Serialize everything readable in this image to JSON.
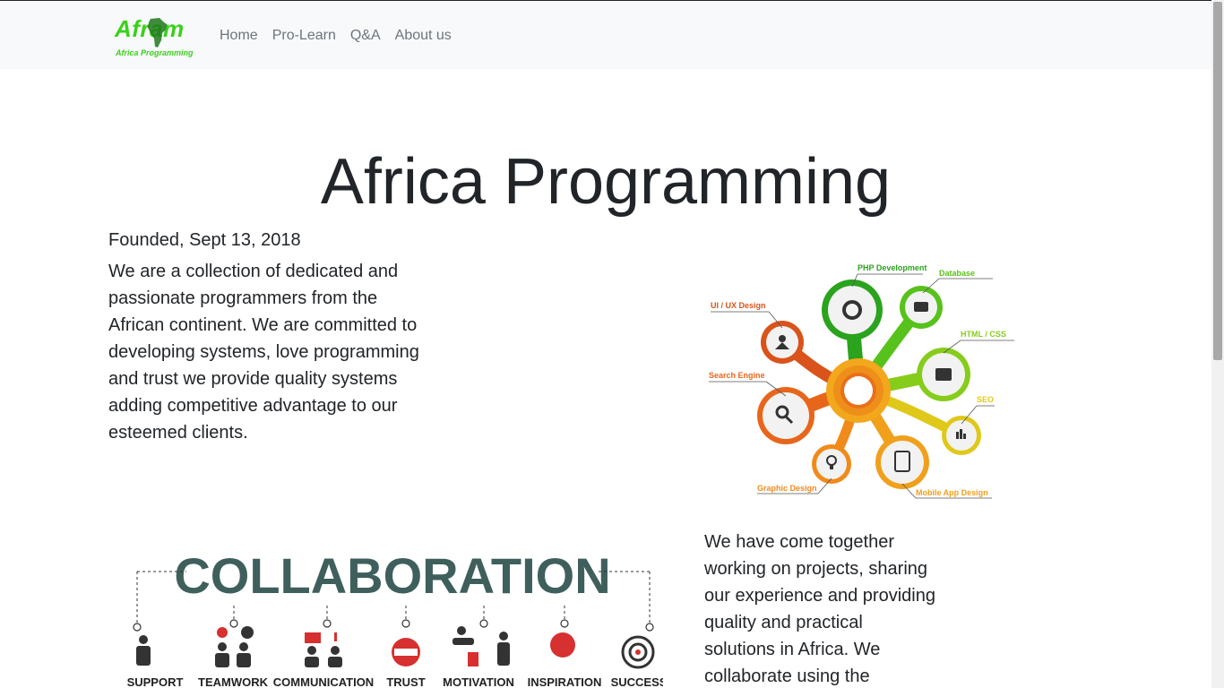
{
  "navbar": {
    "logo": {
      "word": "Afram",
      "subtitle": "Africa Programming"
    },
    "links": [
      {
        "label": "Home"
      },
      {
        "label": "Pro-Learn"
      },
      {
        "label": "Q&A"
      },
      {
        "label": "About us"
      }
    ]
  },
  "hero": {
    "title": "Africa Programming",
    "founded": "Founded, Sept 13, 2018",
    "intro": "We are a collection of dedicated and passionate programmers from the African continent. We are committed to developing systems, love programming and trust we provide quality systems adding competitive advantage to our esteemed clients."
  },
  "skills_graphic": {
    "labels": [
      "PHP Development",
      "Database",
      "UI / UX Design",
      "HTML / CSS",
      "Search Engine",
      "SEO",
      "Graphic Design",
      "Mobile App Design"
    ]
  },
  "collaboration_graphic": {
    "title": "COLLABORATION",
    "items": [
      "SUPPORT",
      "TEAMWORK",
      "COMMUNICATION",
      "TRUST",
      "MOTIVATION",
      "INSPIRATION",
      "SUCCESS"
    ]
  },
  "together": {
    "text": "We have come together working on projects, sharing our experience and providing quality and practical solutions in Africa. We collaborate using the"
  }
}
